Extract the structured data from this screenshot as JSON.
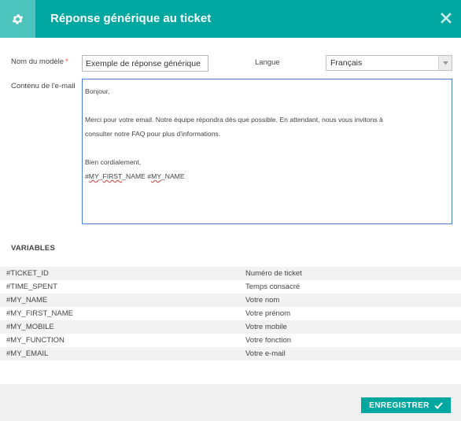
{
  "dialog": {
    "title": "Réponse générique au ticket",
    "close_label": "×"
  },
  "form": {
    "name_label": "Nom du modèle",
    "name_required_mark": "*",
    "name_value": "Exemple de réponse générique",
    "language_label": "Langue",
    "language_value": "Français",
    "content_label": "Contenu de l'e-mail",
    "content_lines": [
      "Bonjour,",
      "",
      "Merci pour votre email. Notre équipe répondra dès que possible. En attendant, nous vous invitons à",
      "consulter notre FAQ pour plus d'informations.",
      "",
      "Bien cordialement,",
      "#MY_FIRST_NAME #MY_NAME"
    ]
  },
  "variables": {
    "title": "VARIABLES",
    "rows": [
      {
        "key": "#TICKET_ID",
        "desc": "Numéro de ticket"
      },
      {
        "key": "#TIME_SPENT",
        "desc": "Temps consacré"
      },
      {
        "key": "#MY_NAME",
        "desc": "Votre nom"
      },
      {
        "key": "#MY_FIRST_NAME",
        "desc": "Votre prénom"
      },
      {
        "key": "#MY_MOBILE",
        "desc": "Votre mobile"
      },
      {
        "key": "#MY_FUNCTION",
        "desc": "Votre fonction"
      },
      {
        "key": "#MY_EMAIL",
        "desc": "Votre e-mail"
      }
    ]
  },
  "footer": {
    "save_label": "ENREGISTRER"
  },
  "colors": {
    "header": "#00a7a0",
    "header_icon_bg": "#4cc3bd",
    "editor_border": "#4a7ed2",
    "required": "#e03b3b"
  },
  "icons": {
    "header": "gear-icon",
    "close": "close-icon",
    "select": "chevron-down-icon",
    "save": "check-icon"
  }
}
